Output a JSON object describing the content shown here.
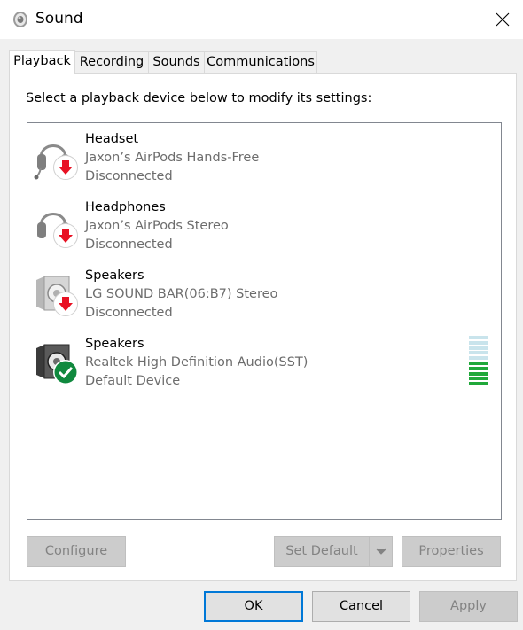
{
  "window": {
    "title": "Sound"
  },
  "tabs": [
    {
      "label": "Playback",
      "active": true
    },
    {
      "label": "Recording",
      "active": false
    },
    {
      "label": "Sounds",
      "active": false
    },
    {
      "label": "Communications",
      "active": false
    }
  ],
  "panel": {
    "instruction": "Select a playback device below to modify its settings:"
  },
  "devices": [
    {
      "name": "Headset",
      "description": "Jaxon’s AirPods Hands-Free",
      "status": "Disconnected",
      "icon": "headset-icon",
      "badge": "disconnected-arrow"
    },
    {
      "name": "Headphones",
      "description": "Jaxon’s AirPods Stereo",
      "status": "Disconnected",
      "icon": "headphones-icon",
      "badge": "disconnected-arrow"
    },
    {
      "name": "Speakers",
      "description": "LG SOUND BAR(06:B7) Stereo",
      "status": "Disconnected",
      "icon": "speaker-icon",
      "badge": "disconnected-arrow"
    },
    {
      "name": "Speakers",
      "description": "Realtek High Definition Audio(SST)",
      "status": "Default Device",
      "icon": "speaker-icon",
      "badge": "default-check"
    }
  ],
  "level_meter": {
    "total_segments": 10,
    "active_segments": 5,
    "active_color": "#20a83a",
    "inactive_color": "#c9e4ec"
  },
  "buttons": {
    "configure": "Configure",
    "set_default": "Set Default",
    "properties": "Properties",
    "ok": "OK",
    "cancel": "Cancel",
    "apply": "Apply"
  },
  "colors": {
    "accent": "#0078d7",
    "disconnected_badge": "#e81123",
    "default_badge": "#10893e"
  }
}
